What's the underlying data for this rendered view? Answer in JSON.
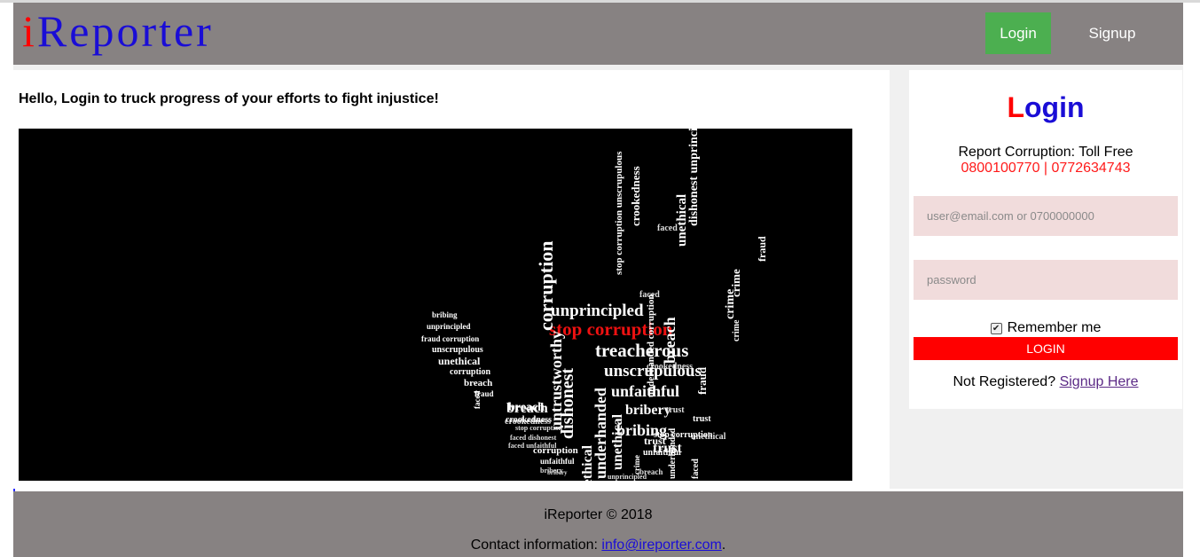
{
  "header": {
    "logo_i": "i",
    "logo_rest": "Reporter",
    "nav_login": "Login",
    "nav_signup": "Signup"
  },
  "main": {
    "tagline": "Hello, Login to truck progress of your efforts to fight injustice!",
    "hero_words": [
      "stop corruption",
      "unprincipled",
      "treacherous",
      "unscrupulous",
      "unfaithful",
      "bribery",
      "bribing",
      "trust",
      "breach",
      "crookedness",
      "dishonest",
      "corruption",
      "unethical",
      "faced",
      "fraud",
      "crime",
      "untrustworthy",
      "underhanded",
      "stop corruption unscrupulous",
      "crookedness",
      "faced",
      "dishonest unprincipled",
      "unethical",
      "breach",
      "fraud",
      "crime",
      "bribing",
      "unprincipled",
      "fraud corruption",
      "unscrupulous",
      "unethical",
      "corruption",
      "breach",
      "fraud",
      "faced",
      "breach",
      "crookedness",
      "stop corruption",
      "faced dishonest",
      "faced unfaithful",
      "corruption",
      "unfaithful",
      "bribery",
      "crookedness",
      "underhanded corruption",
      "trust",
      "unfaithful",
      "bribery",
      "unethical",
      "trust",
      "unethical",
      "crime",
      "trust",
      "stop corruption",
      "crime",
      "underhanded",
      "faced",
      "breach",
      "unprincipled"
    ]
  },
  "login": {
    "title_first": "L",
    "title_rest": "ogin",
    "toll_label": "Report Corruption: Toll Free",
    "toll_numbers": "0800100770 | 0772634743",
    "user_placeholder": "user@email.com or 0700000000",
    "password_placeholder": "password",
    "remember_label": "Remember me",
    "remember_checked": true,
    "login_button": "LOGIN",
    "not_registered": "Not Registered?",
    "signup_link": "Signup Here"
  },
  "footer": {
    "copyright": "iReporter © 2018",
    "contact_label": "Contact information:",
    "contact_email": "info@ireporter.com",
    "contact_suffix": "."
  },
  "colors": {
    "header_bg": "#878282",
    "logo_red": "#ff0000",
    "logo_blue": "#1a0dd6",
    "nav_login_green": "#4caf50",
    "login_button_red": "#ff0000",
    "input_bg": "#f1dcdc"
  }
}
